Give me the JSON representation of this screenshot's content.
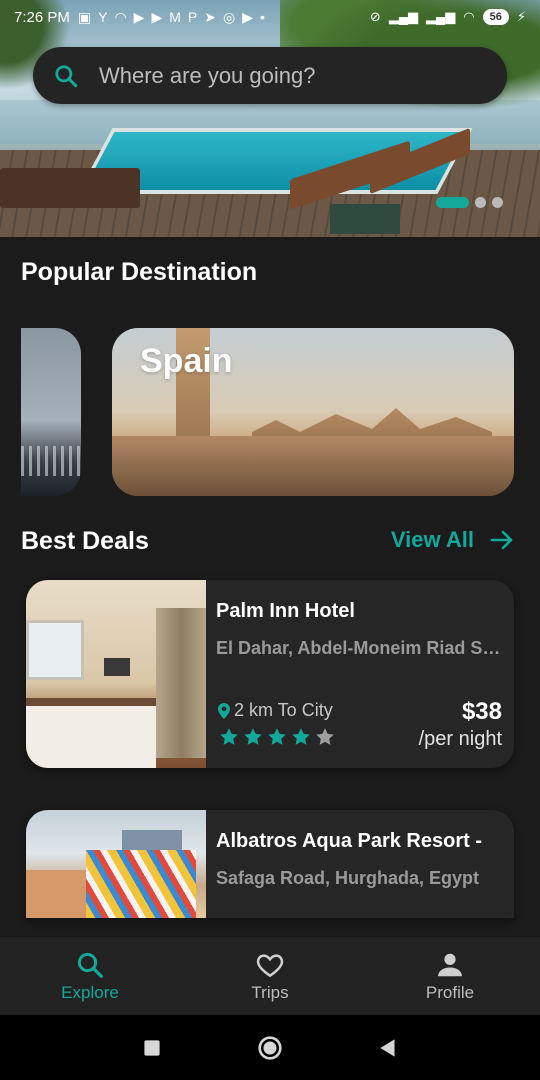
{
  "status_bar": {
    "time": "7:26 PM",
    "battery": "56"
  },
  "search": {
    "placeholder": "Where are you going?"
  },
  "popular": {
    "title": "Popular Destination",
    "destinations": [
      {
        "name": "Spain"
      }
    ]
  },
  "deals": {
    "title": "Best Deals",
    "view_all": "View All",
    "items": [
      {
        "name": "Palm Inn Hotel",
        "address": "El Dahar, Abdel-Moneim Riad Square",
        "distance": "2 km To City",
        "price": "$38",
        "unit": "/per night",
        "rating": 4,
        "rating_max": 5
      },
      {
        "name": "Albatros Aqua Park Resort -",
        "address": "Safaga Road, Hurghada, Egypt"
      }
    ]
  },
  "nav": {
    "items": [
      {
        "label": "Explore",
        "icon": "search-icon",
        "active": true
      },
      {
        "label": "Trips",
        "icon": "heart-icon",
        "active": false
      },
      {
        "label": "Profile",
        "icon": "person-icon",
        "active": false
      }
    ]
  },
  "colors": {
    "accent": "#12a89a",
    "background": "#1b1b1b",
    "card": "#262626",
    "star_inactive": "#9e9e9e"
  }
}
